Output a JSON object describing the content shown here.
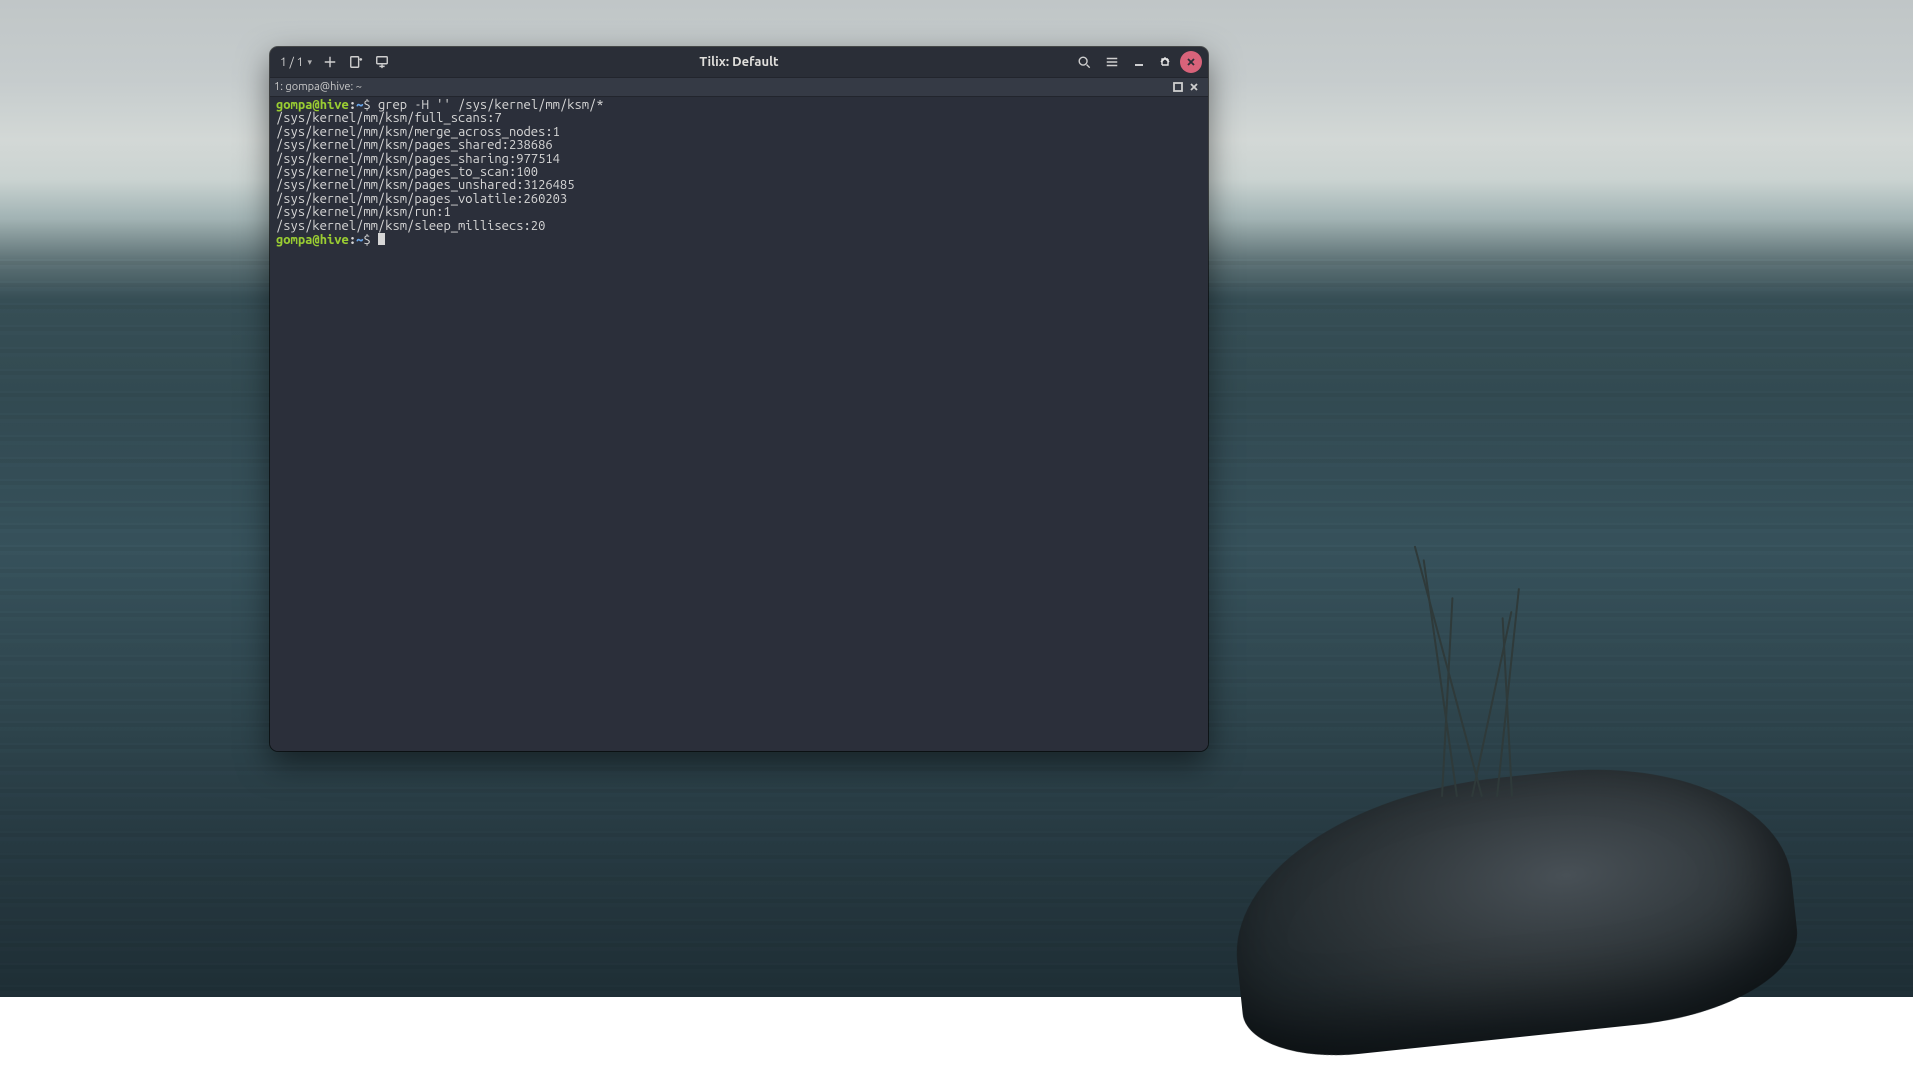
{
  "window": {
    "title": "Tilix: Default",
    "session_counter": "1 / 1",
    "tab_label": "1: gompa@hive: ~"
  },
  "icons": {
    "chevron_down": "chevron-down-icon",
    "plus": "plus-icon",
    "new_terminal": "new-terminal-icon",
    "split_below": "split-below-icon",
    "search": "search-icon",
    "menu": "hamburger-icon",
    "minimize": "minimize-icon",
    "maximize": "maximize-icon",
    "close": "close-icon",
    "tab_maximize": "tab-maximize-icon",
    "tab_close": "tab-close-icon"
  },
  "colors": {
    "titlebar_bg": "#2a2e37",
    "terminal_bg": "#2b2f3a",
    "text": "#d6d6d6",
    "prompt_userhost": "#9acd32",
    "prompt_path": "#6aa7ec",
    "close_button": "#d8637a"
  },
  "prompt": {
    "user": "gompa",
    "host": "hive",
    "path": "~",
    "symbol": "$"
  },
  "command": "grep -H '' /sys/kernel/mm/ksm/*",
  "output_lines": [
    "/sys/kernel/mm/ksm/full_scans:7",
    "/sys/kernel/mm/ksm/merge_across_nodes:1",
    "/sys/kernel/mm/ksm/pages_shared:238686",
    "/sys/kernel/mm/ksm/pages_sharing:977514",
    "/sys/kernel/mm/ksm/pages_to_scan:100",
    "/sys/kernel/mm/ksm/pages_unshared:3126485",
    "/sys/kernel/mm/ksm/pages_volatile:260203",
    "/sys/kernel/mm/ksm/run:1",
    "/sys/kernel/mm/ksm/sleep_millisecs:20"
  ]
}
